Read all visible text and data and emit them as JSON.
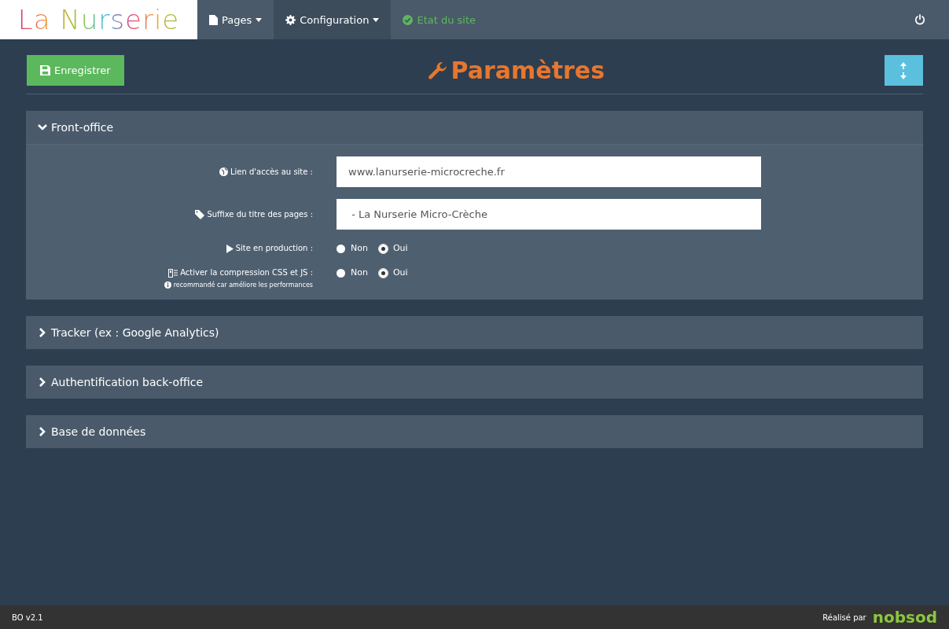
{
  "navbar": {
    "logo": "La Nurserie",
    "items": [
      {
        "kind": "pages",
        "label": "Pages",
        "selected": false
      },
      {
        "kind": "config",
        "label": "Configuration",
        "selected": true
      },
      {
        "kind": "status",
        "label": "Etat du site",
        "selected": false
      }
    ]
  },
  "toolbar": {
    "save_button": "Enregistrer",
    "title": "Paramètres"
  },
  "sections": [
    {
      "title": "Front-office",
      "expanded": true,
      "fields": [
        {
          "kind": "text",
          "label": "Lien d'accès au site :",
          "value": "www.lanurserie-microcreche.fr"
        },
        {
          "kind": "text",
          "label": "Suffixe du titre des pages :",
          "value": " - La Nurserie Micro-Crèche"
        },
        {
          "kind": "radio",
          "label": "Site en production :",
          "options": [
            {
              "label": "Non",
              "selected": false
            },
            {
              "label": "Oui",
              "selected": true
            }
          ]
        },
        {
          "kind": "radio",
          "label": "Activer la compression CSS et JS :",
          "hint": "recommandé car améliore les performances",
          "options": [
            {
              "label": "Non",
              "selected": false
            },
            {
              "label": "Oui",
              "selected": true
            }
          ]
        }
      ]
    },
    {
      "title": "Tracker (ex : Google Analytics)",
      "expanded": false
    },
    {
      "title": "Authentification back-office",
      "expanded": false
    },
    {
      "title": "Base de données",
      "expanded": false
    }
  ],
  "footer": {
    "version": "BO v2.1",
    "credit": "Réalisé par",
    "brand": "nobsod"
  }
}
